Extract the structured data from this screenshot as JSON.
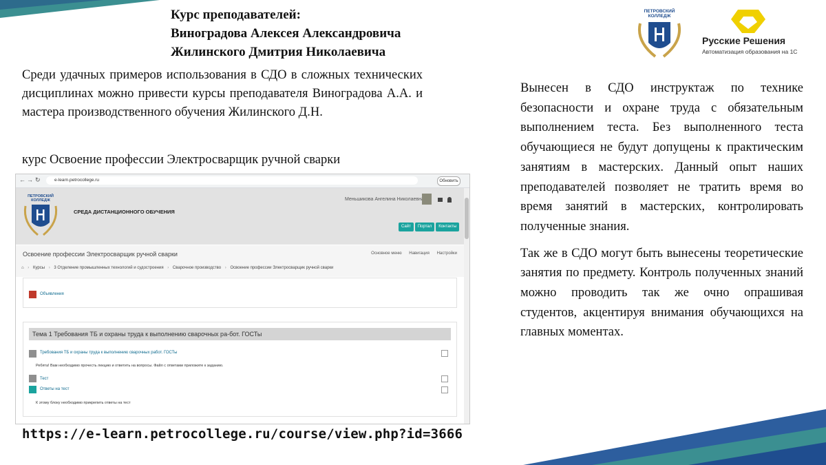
{
  "title_lines": [
    "Курс преподавателей:",
    "Виноградова Алексея Александровича",
    "Жилинского Дмитрия Николаевича"
  ],
  "left_paragraph": "Среди удачных примеров использования в СДО в сложных технических дисциплинах можно привести курсы преподавателя Виноградова А.А. и мастера производственного обучения Жилинского Д.Н.",
  "course_label": "курс Освоение профессии Электросварщик ручной сварки",
  "right_paragraphs": [
    "Вынесен в СДО инструктаж по технике безопасности и охране труда с обязательным выполнением теста. Без выполненного теста обучающиеся не будут допущены к практическим занятиям в мастерских. Данный опыт наших преподавателей позволяет не тратить время во время занятий в мастерских, контролировать полученные знания.",
    "Так же в СДО могут быть вынесены теоретические занятия по предмету. Контроль полученных знаний можно проводить так же очно опрашивая студентов, акцентируя внимания обучающихся на главных моментах."
  ],
  "url": "https://e-learn.petrocollege.ru/course/view.php?id=3666",
  "logos": {
    "college_name": "ПЕТРОВСКИЙ КОЛЛЕДЖ",
    "college_motto": "LEARNING BY DOING",
    "partner_name": "Русские Решения",
    "partner_subtitle": "Автоматизация образования на 1С"
  },
  "screenshot": {
    "address": "e-learn.petrocollege.ru",
    "update_button": "Обновить",
    "header_logo": "ПЕТРОВСКИЙ КОЛЛЕДЖ",
    "site_title": "СРЕДА ДИСТАНЦИОННОГО ОБУЧЕНИЯ",
    "user_name": "Меньшикова Ангелина Николаевна",
    "header_buttons": [
      "Сайт",
      "Портал",
      "Контакты"
    ],
    "course_title": "Освоение профессии Электросварщик ручной сварки",
    "menu_links": [
      "Основное меню",
      "Навигация",
      "Настройки"
    ],
    "breadcrumbs": [
      "Курсы",
      "3 Отделение промышленных технологий и судостроения",
      "Сварочное производство",
      "Освоение профессии Электросварщик ручной сварки"
    ],
    "forum_link": "Объявления",
    "topic_title": "Тема 1 Требования ТБ и охраны труда к выполнению сварочных ра-бот. ГОСТы",
    "activities": [
      {
        "link": "Требования ТБ и охраны труда к выполнению сварочных работ. ГОСТы",
        "desc": "Ребята! Вам необходимо прочесть лекцию и ответить на вопросы. Файл с ответами приложите к заданию."
      },
      {
        "link": "Тест",
        "desc": ""
      },
      {
        "link": "Ответы на тест",
        "desc": "К этому блоку необходимо прикрепить ответы на тест"
      }
    ]
  },
  "colors": {
    "accent_teal": "#1aa39e",
    "decor_teal": "#3b8f91",
    "decor_blue": "#1f4d8f",
    "partner_yellow": "#f0d000"
  }
}
